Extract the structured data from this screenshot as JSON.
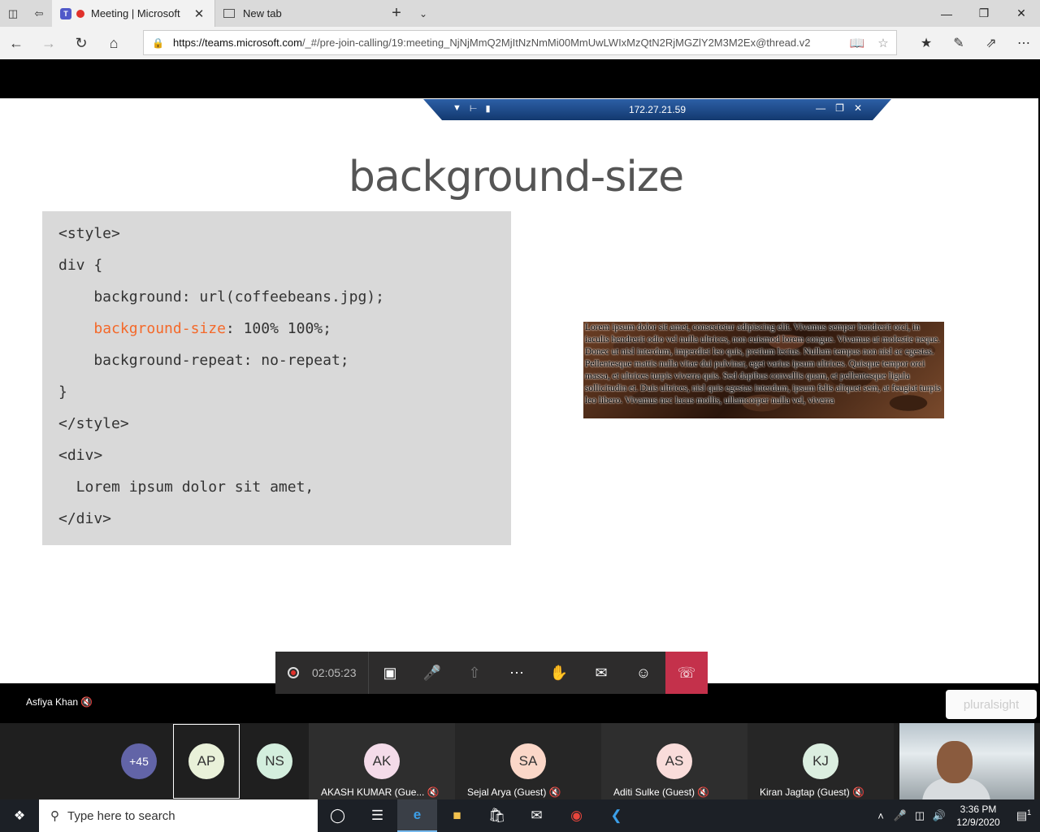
{
  "browser": {
    "tabs": [
      {
        "title": "Meeting | Microsoft",
        "active": true
      },
      {
        "title": "New tab",
        "active": false
      }
    ],
    "url_domain": "https://teams.microsoft.com",
    "url_path": "/_#/pre-join-calling/19:meeting_NjNjMmQ2MjItNzNmMi00MmUwLWIxMzQtN2RjMGZlY2M3M2Ex@thread.v2"
  },
  "rdp": {
    "host": "172.27.21.59"
  },
  "slide": {
    "title": "background-size",
    "code": [
      {
        "pre": "<style>",
        "hl": "",
        "post": ""
      },
      {
        "pre": "div {",
        "hl": "",
        "post": ""
      },
      {
        "pre": "    background: url(coffeebeans.jpg);",
        "hl": "",
        "post": ""
      },
      {
        "pre": "    ",
        "hl": "background-size",
        "post": ": 100% 100%;"
      },
      {
        "pre": "    background-repeat: no-repeat;",
        "hl": "",
        "post": ""
      },
      {
        "pre": "}",
        "hl": "",
        "post": ""
      },
      {
        "pre": "</style>",
        "hl": "",
        "post": ""
      },
      {
        "pre": "<div>",
        "hl": "",
        "post": ""
      },
      {
        "pre": "  Lorem ipsum dolor sit amet,",
        "hl": "",
        "post": ""
      },
      {
        "pre": "</div>",
        "hl": "",
        "post": ""
      }
    ],
    "demo_text": "Lorem ipsum dolor sit amet, consectetur adipiscing elit. Vivamus semper hendrerit orci, in iaculis hendrerit odio vel nulla ultrices, non euismod lorem congue. Vivamus ut molestie neque. Donec ut nisl interdum, imperdiet leo quis, pretium lectus. Nullam tempus non nisl ac egestas. Pellentesque mattis nulla vitae dui pulvinar, eget varius ipsum ultrices. Quisque tempor orci massa, et ultrices turpis viverra quis. Sed dapibus convallis quam, et pellentesque ligula sollicitudin et. Duis ultrices, nisl quis egestas interdum, ipsum felis aliquet sem, at feugiat turpis leo libero. Vivamus nec lacus mollis, ullamcorper nulla vel, viverra",
    "watermark": "pluralsight"
  },
  "call": {
    "timer": "02:05:23",
    "speaker": "Asfiya Khan"
  },
  "participants": {
    "overflow": "+45",
    "small": [
      {
        "initials": "AP",
        "color": "#e9f1d9"
      },
      {
        "initials": "NS",
        "color": "#d3eedd"
      }
    ],
    "tiles": [
      {
        "initials": "AK",
        "name": "AKASH KUMAR (Gue...",
        "color": "#f4dbe9"
      },
      {
        "initials": "SA",
        "name": "Sejal Arya (Guest)",
        "color": "#fbd7c8"
      },
      {
        "initials": "AS",
        "name": "Aditi Sulke (Guest)",
        "color": "#f9dcda"
      },
      {
        "initials": "KJ",
        "name": "Kiran Jagtap (Guest)",
        "color": "#dbeee0"
      }
    ]
  },
  "taskbar": {
    "search_placeholder": "Type here to search",
    "time": "3:36 PM",
    "date": "12/9/2020",
    "notif_count": "1"
  }
}
